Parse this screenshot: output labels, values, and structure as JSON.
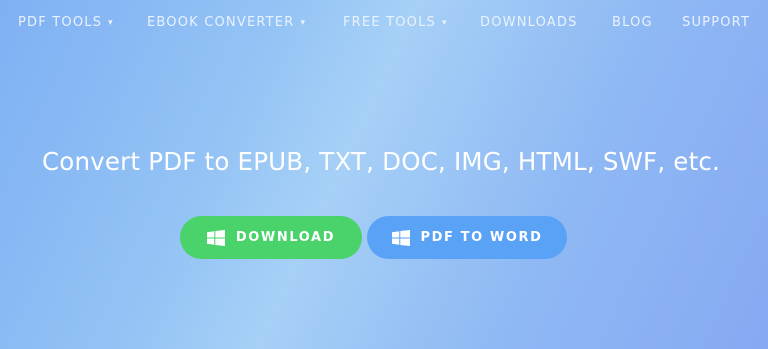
{
  "nav": {
    "items": [
      {
        "label": "PDF TOOLS",
        "has_dropdown": true
      },
      {
        "label": "EBOOK CONVERTER",
        "has_dropdown": true
      },
      {
        "label": "FREE TOOLS",
        "has_dropdown": true
      },
      {
        "label": "DOWNLOADS",
        "has_dropdown": false
      },
      {
        "label": "BLOG",
        "has_dropdown": false
      },
      {
        "label": "SUPPORT",
        "has_dropdown": false
      }
    ],
    "caret": "▾"
  },
  "hero": {
    "headline": "Convert PDF to EPUB, TXT, DOC, IMG, HTML, SWF, etc."
  },
  "buttons": {
    "download_label": "DOWNLOAD",
    "download_icon": "windows-icon",
    "download_color": "#49d36a",
    "pdf_to_word_label": "PDF TO WORD",
    "pdf_to_word_icon": "windows-icon",
    "pdf_to_word_color": "#5aa2f6"
  }
}
